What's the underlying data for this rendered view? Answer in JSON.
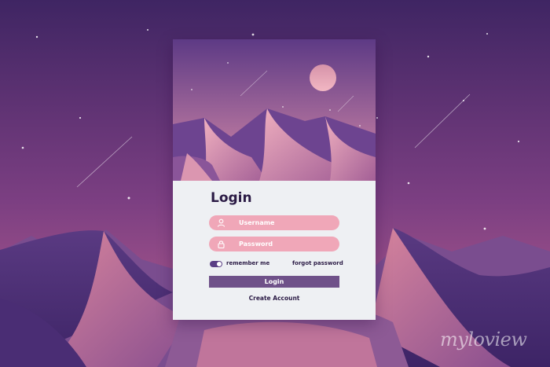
{
  "login": {
    "title": "Login",
    "username_placeholder": "Username",
    "password_placeholder": "Password",
    "remember_label": "remember me",
    "remember_checked": true,
    "forgot_label": "forgot password",
    "login_button": "Login",
    "create_account": "Create Account"
  },
  "icons": {
    "username": "user-icon",
    "password": "lock-icon"
  },
  "watermark": "myloview",
  "colors": {
    "sky_top": "#3f2563",
    "sky_bottom": "#b9608f",
    "field": "#f0a7b8",
    "button": "#6f5189",
    "text": "#2b1b45",
    "form_bg": "#eef0f3"
  }
}
